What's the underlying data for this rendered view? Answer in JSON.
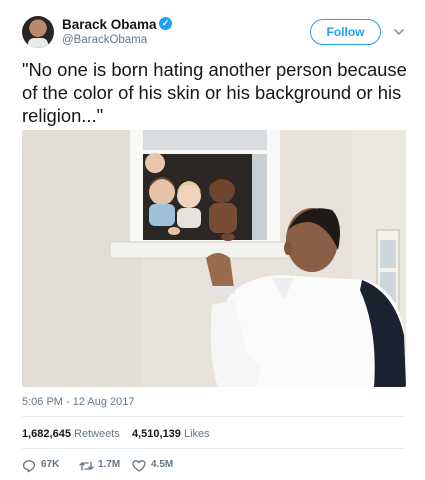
{
  "author": {
    "name": "Barack Obama",
    "handle": "@BarackObama",
    "verified": true
  },
  "follow_label": "Follow",
  "tweet": {
    "text": "\"No one is born hating another person because of the color of his skin or his background or his religion...\""
  },
  "media": {
    "icon": "photo"
  },
  "timestamp": "5:06 PM - 12 Aug 2017",
  "stats": {
    "retweets_value": "1,682,645",
    "retweets_label": "Retweets",
    "likes_value": "4,510,139",
    "likes_label": "Likes"
  },
  "actions": {
    "reply_count": "67K",
    "retweet_count": "1.7M",
    "like_count": "4.5M"
  },
  "colors": {
    "accent": "#1da1f2",
    "muted": "#657786",
    "text": "#14171a"
  }
}
